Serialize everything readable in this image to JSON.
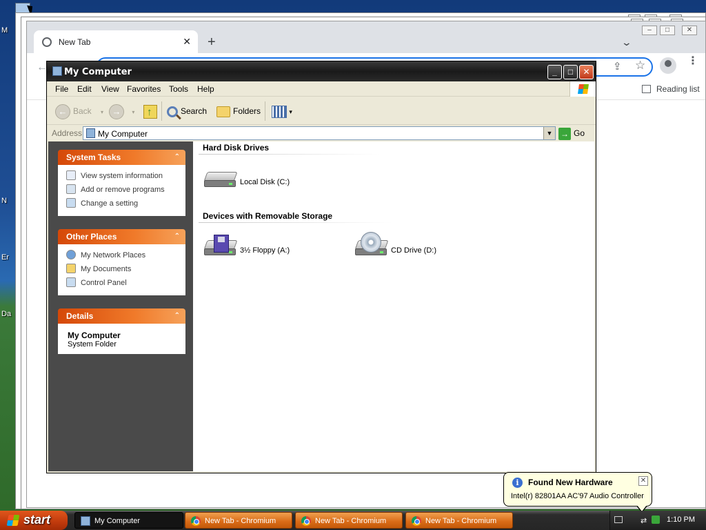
{
  "desktop": {
    "icon_labels": [
      "M",
      "N",
      "Er",
      "Da"
    ]
  },
  "chromium": {
    "tab_title": "New Tab",
    "tab_close": "✕",
    "new_tab": "+",
    "tab_search": "⌄",
    "back": "←",
    "share": "⇪",
    "bookmark_star": "☆",
    "menu": "⋮",
    "reading_list": "Reading list"
  },
  "explorer": {
    "title": "My Computer",
    "title_buttons": {
      "minimize": "_",
      "maximize": "□",
      "close": "✕"
    },
    "menu": [
      "File",
      "Edit",
      "View",
      "Favorites",
      "Tools",
      "Help"
    ],
    "toolbar": {
      "back": "Back",
      "back_arrow": "←",
      "forward_arrow": "→",
      "search": "Search",
      "folders": "Folders",
      "views_arrow": "▾"
    },
    "address": {
      "label": "Address",
      "value": "My Computer",
      "dropdown": "▼",
      "go": "Go",
      "go_arrow": "→"
    },
    "system_tasks": {
      "title": "System Tasks",
      "chevron": "⌃",
      "items": [
        "View system information",
        "Add or remove programs",
        "Change a setting"
      ]
    },
    "other_places": {
      "title": "Other Places",
      "chevron": "⌃",
      "items": [
        "My Network Places",
        "My Documents",
        "Control Panel"
      ]
    },
    "details": {
      "title": "Details",
      "chevron": "⌃",
      "name": "My Computer",
      "type": "System Folder"
    },
    "groups": {
      "hard_disks": {
        "title": "Hard Disk Drives",
        "items": [
          "Local Disk (C:)"
        ]
      },
      "removable": {
        "title": "Devices with Removable Storage",
        "items": [
          "3½ Floppy (A:)",
          "CD Drive (D:)"
        ]
      }
    }
  },
  "balloon": {
    "icon": "i",
    "title": "Found New Hardware",
    "message": "Intel(r) 82801AA AC'97 Audio Controller",
    "close": "✕"
  },
  "taskbar": {
    "start": "start",
    "tasks": [
      "My Computer",
      "New Tab - Chromium",
      "New Tab - Chromium",
      "New Tab - Chromium"
    ],
    "tray_net": "⇄",
    "clock": "1:10 PM"
  },
  "colors": {
    "xp_orange": "#e0561c",
    "panel_header": "#f07a2a",
    "chromium_focus": "#1a73e8",
    "balloon_bg": "#ffffe1"
  }
}
